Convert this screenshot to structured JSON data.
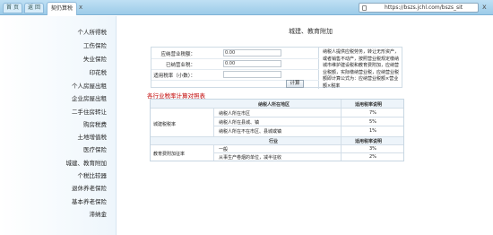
{
  "browser": {
    "tab_home": "首 页",
    "tab_back": "返 回",
    "tab_active": "契仍算税",
    "tab_close": "x",
    "url": "https://bszs.jchl.com/bszs_sit",
    "url_close": "x"
  },
  "sidebar": {
    "items": [
      {
        "label": "个人所得税"
      },
      {
        "label": "工伤保险"
      },
      {
        "label": "失业保险"
      },
      {
        "label": "印花税"
      },
      {
        "label": "个人房屋出租"
      },
      {
        "label": "企业房屋出租"
      },
      {
        "label": "二手住房转让"
      },
      {
        "label": "购房税费"
      },
      {
        "label": "土地增值税"
      },
      {
        "label": "医疗保险"
      },
      {
        "label": "城建、教育附加"
      },
      {
        "label": "个税比较器"
      },
      {
        "label": "退休养老保险"
      },
      {
        "label": "基本养老保险"
      },
      {
        "label": "滞纳金"
      }
    ]
  },
  "main": {
    "title": "城建、教育附加",
    "form": {
      "rows": [
        {
          "label": "应纳营业税额：",
          "value": "0.00"
        },
        {
          "label": "已纳营业税：",
          "value": "0.00"
        },
        {
          "label": "适用税率（小数）：",
          "value": ""
        }
      ],
      "note": "纳税人提供应税劳务，转让无形资产，或者销售不动产，按照营业税规定缴纳城市维护建设税和教育费附加，应纳营业税额，实际缴纳营业税，应纳营业税额即计算公式为：应纳营业税额×营业额×税率",
      "button": "计算"
    },
    "section_title": "各行业税率计算对照表",
    "table": {
      "header_location": "纳税人所在地区",
      "header_rate": "适用税率说明",
      "group1": "城建税税率",
      "rows1": [
        {
          "label": "纳税人所在市区",
          "rate": "7%"
        },
        {
          "label": "纳税人所在县城、镇",
          "rate": "5%"
        },
        {
          "label": "纳税人所在不在市区、县城或镇",
          "rate": "1%"
        }
      ],
      "header_industry": "行业",
      "header_rate2": "适用税率说明",
      "group2": "教育费附加征率",
      "rows2": [
        {
          "label": "一般",
          "rate": "3%"
        },
        {
          "label": "从事生产卷烟的单位，减半征收",
          "rate": "2%"
        }
      ]
    }
  }
}
